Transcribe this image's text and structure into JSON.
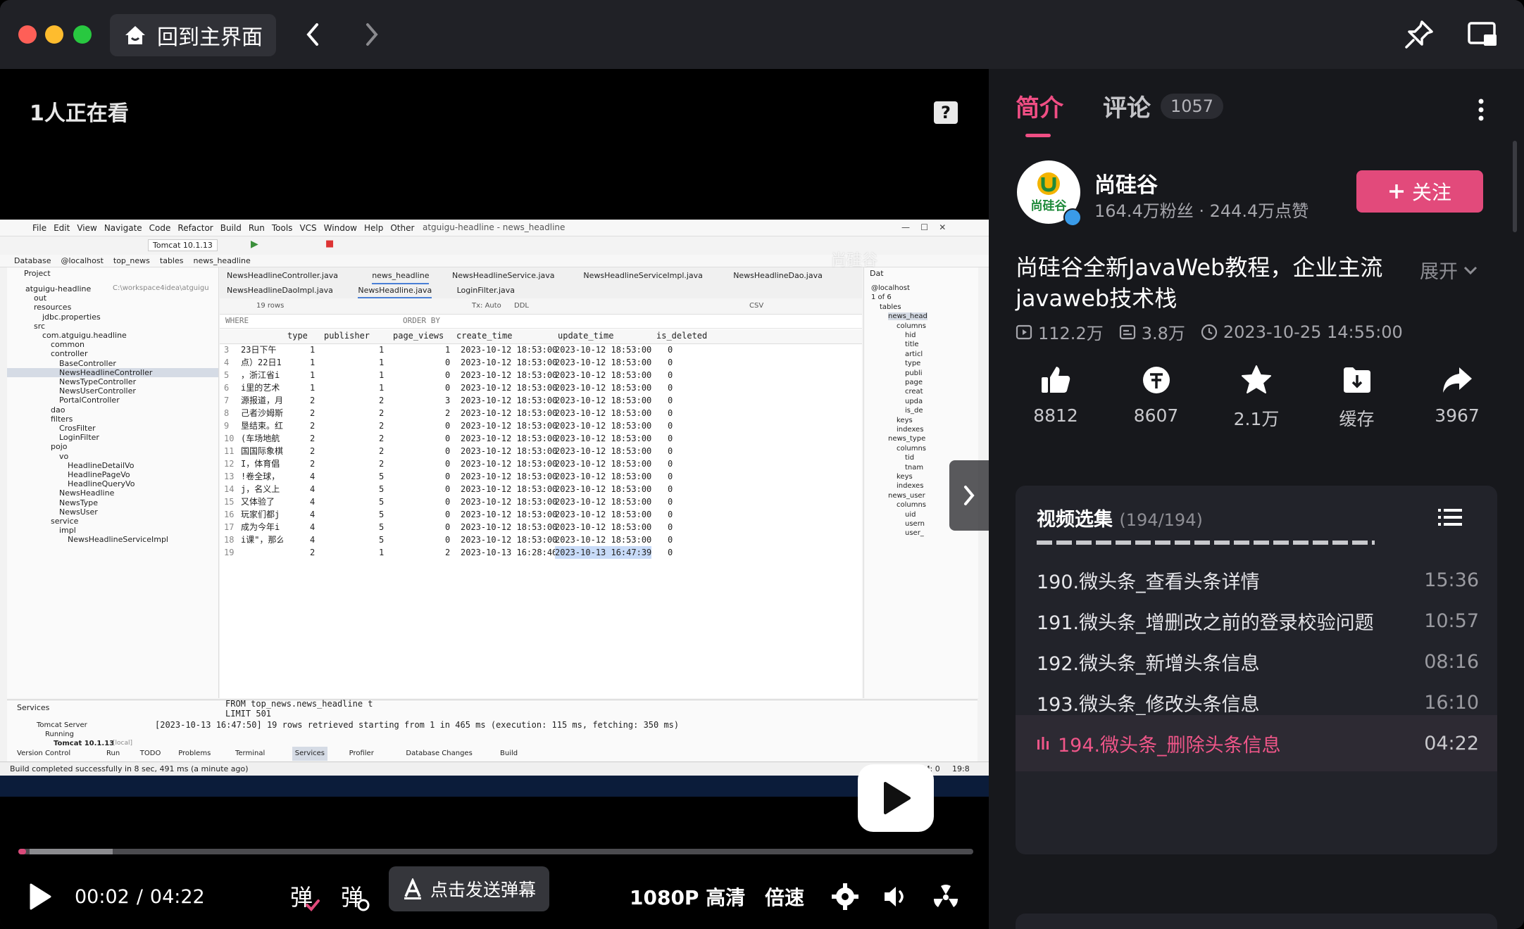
{
  "titlebar": {
    "home_label": "回到主界面"
  },
  "player": {
    "watching": "1人正在看",
    "time_current": "00:02",
    "time_sep": "/",
    "time_total": "04:22",
    "progress_fraction": 0.008,
    "danmu_placeholder": "点击发送弹幕",
    "quality": "1080P 高清",
    "speed": "倍速"
  },
  "ide": {
    "menu": [
      "File",
      "Edit",
      "View",
      "Navigate",
      "Code",
      "Refactor",
      "Build",
      "Run",
      "Tools",
      "VCS",
      "Window",
      "Help",
      "Other"
    ],
    "window_title": "atguigu-headline - news_headline",
    "run_config": "Tomcat 10.1.13",
    "breadcrumb": [
      "Database",
      "@localhost",
      "top_news",
      "tables",
      "news_headline"
    ],
    "project_label": "Project",
    "tree": [
      {
        "t": "atguigu-headline",
        "d": 1
      },
      {
        "t": "C:\\workspace4idea\\atguigu",
        "d": 0
      },
      {
        "t": "out",
        "d": 2
      },
      {
        "t": "resources",
        "d": 2
      },
      {
        "t": "jdbc.properties",
        "d": 3
      },
      {
        "t": "src",
        "d": 2
      },
      {
        "t": "com.atguigu.headline",
        "d": 3
      },
      {
        "t": "common",
        "d": 4
      },
      {
        "t": "controller",
        "d": 4
      },
      {
        "t": "BaseController",
        "d": 5
      },
      {
        "t": "NewsHeadlineController",
        "d": 5
      },
      {
        "t": "NewsTypeController",
        "d": 5
      },
      {
        "t": "NewsUserController",
        "d": 5
      },
      {
        "t": "PortalController",
        "d": 5
      },
      {
        "t": "dao",
        "d": 4
      },
      {
        "t": "filters",
        "d": 4
      },
      {
        "t": "CrosFilter",
        "d": 5
      },
      {
        "t": "LoginFilter",
        "d": 5
      },
      {
        "t": "pojo",
        "d": 4
      },
      {
        "t": "vo",
        "d": 5
      },
      {
        "t": "HeadlineDetailVo",
        "d": 6
      },
      {
        "t": "HeadlinePageVo",
        "d": 6
      },
      {
        "t": "HeadlineQueryVo",
        "d": 6
      },
      {
        "t": "NewsHeadline",
        "d": 5
      },
      {
        "t": "NewsType",
        "d": 5
      },
      {
        "t": "NewsUser",
        "d": 5
      },
      {
        "t": "service",
        "d": 4
      },
      {
        "t": "impl",
        "d": 5
      },
      {
        "t": "NewsHeadlineServiceImpl",
        "d": 6
      }
    ],
    "tabs_row1": [
      "NewsHeadlineController.java",
      "news_headline",
      "NewsHeadlineService.java",
      "NewsHeadlineServiceImpl.java",
      "NewsHeadlineDao.java"
    ],
    "tabs_row2": [
      "NewsHeadlineDaoImpl.java",
      "NewsHeadline.java",
      "LoginFilter.java"
    ],
    "grid_toolbar": {
      "rows": "19 rows",
      "tx": "Tx: Auto",
      "ddl": "DDL",
      "csv": "CSV"
    },
    "where": "WHERE",
    "order_by": "ORDER BY",
    "columns": [
      "type",
      "publisher",
      "page_views",
      "create_time",
      "update_time",
      "is_deleted"
    ],
    "rows": [
      {
        "n": "3",
        "a": "23日下午",
        "type": "1",
        "pub": "1",
        "pv": "1",
        "c": "2023-10-12 18:53:00",
        "u": "2023-10-12 18:53:00",
        "d": "0"
      },
      {
        "n": "4",
        "a": "点）22日1",
        "type": "1",
        "pub": "1",
        "pv": "0",
        "c": "2023-10-12 18:53:00",
        "u": "2023-10-12 18:53:00",
        "d": "0"
      },
      {
        "n": "5",
        "a": "，浙江省i",
        "type": "1",
        "pub": "1",
        "pv": "0",
        "c": "2023-10-12 18:53:00",
        "u": "2023-10-12 18:53:00",
        "d": "0"
      },
      {
        "n": "6",
        "a": "i里的艺术",
        "type": "1",
        "pub": "1",
        "pv": "0",
        "c": "2023-10-12 18:53:00",
        "u": "2023-10-12 18:53:00",
        "d": "0"
      },
      {
        "n": "7",
        "a": "源报道，月",
        "type": "2",
        "pub": "2",
        "pv": "3",
        "c": "2023-10-12 18:53:00",
        "u": "2023-10-12 18:53:00",
        "d": "0"
      },
      {
        "n": "8",
        "a": "己者沙姆斯",
        "type": "2",
        "pub": "2",
        "pv": "2",
        "c": "2023-10-12 18:53:00",
        "u": "2023-10-12 18:53:00",
        "d": "0"
      },
      {
        "n": "9",
        "a": "垦结束。红",
        "type": "2",
        "pub": "2",
        "pv": "0",
        "c": "2023-10-12 18:53:00",
        "u": "2023-10-12 18:53:00",
        "d": "0"
      },
      {
        "n": "10",
        "a": "(车场地航",
        "type": "2",
        "pub": "2",
        "pv": "0",
        "c": "2023-10-12 18:53:00",
        "u": "2023-10-12 18:53:00",
        "d": "0"
      },
      {
        "n": "11",
        "a": "国国际象棋",
        "type": "2",
        "pub": "2",
        "pv": "0",
        "c": "2023-10-12 18:53:00",
        "u": "2023-10-12 18:53:00",
        "d": "0"
      },
      {
        "n": "12",
        "a": "I，体育倡",
        "type": "2",
        "pub": "2",
        "pv": "0",
        "c": "2023-10-12 18:53:00",
        "u": "2023-10-12 18:53:00",
        "d": "0"
      },
      {
        "n": "13",
        "a": "!卷全球，",
        "type": "4",
        "pub": "5",
        "pv": "0",
        "c": "2023-10-12 18:53:00",
        "u": "2023-10-12 18:53:00",
        "d": "0"
      },
      {
        "n": "14",
        "a": "j，名义上",
        "type": "4",
        "pub": "5",
        "pv": "0",
        "c": "2023-10-12 18:53:00",
        "u": "2023-10-12 18:53:00",
        "d": "0"
      },
      {
        "n": "15",
        "a": "又体验了",
        "type": "4",
        "pub": "5",
        "pv": "0",
        "c": "2023-10-12 18:53:00",
        "u": "2023-10-12 18:53:00",
        "d": "0"
      },
      {
        "n": "16",
        "a": "玩家们都j",
        "type": "4",
        "pub": "5",
        "pv": "0",
        "c": "2023-10-12 18:53:00",
        "u": "2023-10-12 18:53:00",
        "d": "0"
      },
      {
        "n": "17",
        "a": "成为今年i",
        "type": "4",
        "pub": "5",
        "pv": "0",
        "c": "2023-10-12 18:53:00",
        "u": "2023-10-12 18:53:00",
        "d": "0"
      },
      {
        "n": "18",
        "a": "i课\"，那么",
        "type": "4",
        "pub": "5",
        "pv": "0",
        "c": "2023-10-12 18:53:00",
        "u": "2023-10-12 18:53:00",
        "d": "0"
      },
      {
        "n": "19",
        "a": "",
        "type": "2",
        "pub": "1",
        "pv": "2",
        "c": "2023-10-13 16:28:46",
        "u": "2023-10-13 16:47:39",
        "d": "0"
      }
    ],
    "db_tree": [
      {
        "t": "@localhost",
        "d": 0
      },
      {
        "t": "1 of 6",
        "d": 0
      },
      {
        "t": "tables",
        "d": 1
      },
      {
        "t": "news_head",
        "d": 2
      },
      {
        "t": "columns",
        "d": 3
      },
      {
        "t": "hid",
        "d": 4
      },
      {
        "t": "title",
        "d": 4
      },
      {
        "t": "articl",
        "d": 4
      },
      {
        "t": "type",
        "d": 4
      },
      {
        "t": "publi",
        "d": 4
      },
      {
        "t": "page",
        "d": 4
      },
      {
        "t": "creat",
        "d": 4
      },
      {
        "t": "upda",
        "d": 4
      },
      {
        "t": "is_de",
        "d": 4
      },
      {
        "t": "keys",
        "d": 3
      },
      {
        "t": "indexes",
        "d": 3
      },
      {
        "t": "news_type",
        "d": 2
      },
      {
        "t": "columns",
        "d": 3
      },
      {
        "t": "tid",
        "d": 4
      },
      {
        "t": "tnam",
        "d": 4
      },
      {
        "t": "keys",
        "d": 3
      },
      {
        "t": "indexes",
        "d": 3
      },
      {
        "t": "news_user",
        "d": 2
      },
      {
        "t": "columns",
        "d": 3
      },
      {
        "t": "uid",
        "d": 4
      },
      {
        "t": "usern",
        "d": 4
      },
      {
        "t": "user_",
        "d": 4
      }
    ],
    "db_label": "Dat",
    "services_label": "Services",
    "services_tree": [
      "Tomcat Server",
      "Running",
      "Tomcat 10.1.13"
    ],
    "services_tree_local": "[local]",
    "console_lines": [
      "FROM top_news.news_headline t",
      "LIMIT 501",
      "[2023-10-13 16:47:50] 19 rows retrieved starting from 1 in 465 ms (execution: 115 ms, fetching: 350 ms)"
    ],
    "bottom_tabs": [
      "Version Control",
      "Run",
      "TODO",
      "Problems",
      "Terminal",
      "Services",
      "Profiler",
      "Database Changes",
      "Build"
    ],
    "status_text": "Build completed successfully in 8 sec, 491 ms (a minute ago)",
    "status_right": [
      "SUM: 0",
      "19:8"
    ],
    "watermark": "尚硅谷"
  },
  "panel": {
    "tab_intro": "简介",
    "tab_comments": "评论",
    "comment_count": "1057",
    "uploader": "尚硅谷",
    "avatar_text": "尚硅谷",
    "uploader_stats": "164.4万粉丝 · 244.4万点赞",
    "follow_label": "关注",
    "title": "尚硅谷全新JavaWeb教程，企业主流javaweb技术栈",
    "expand": "展开",
    "views": "112.2万",
    "danmaku": "3.8万",
    "date": "2023-10-25 14:55:00",
    "actions": [
      {
        "icon": "like-icon",
        "label": "8812"
      },
      {
        "icon": "coin-icon",
        "label": "8607"
      },
      {
        "icon": "star-icon",
        "label": "2.1万"
      },
      {
        "icon": "download-icon",
        "label": "缓存"
      },
      {
        "icon": "share-icon",
        "label": "3967"
      }
    ],
    "playlist_title": "视频选集",
    "playlist_count": "(194/194)",
    "episodes": [
      {
        "title": "190.微头条_查看头条详情",
        "dur": "15:36"
      },
      {
        "title": "191.微头条_增删改之前的登录校验问题",
        "dur": "10:57"
      },
      {
        "title": "192.微头条_新增头条信息",
        "dur": "08:16"
      },
      {
        "title": "193.微头条_修改头条信息",
        "dur": "16:10"
      },
      {
        "title": "194.微头条_删除头条信息",
        "dur": "04:22"
      }
    ]
  },
  "colors": {
    "accent": "#e24a7b",
    "panel_bg": "#17181c",
    "playlist_bg": "#22232a"
  }
}
